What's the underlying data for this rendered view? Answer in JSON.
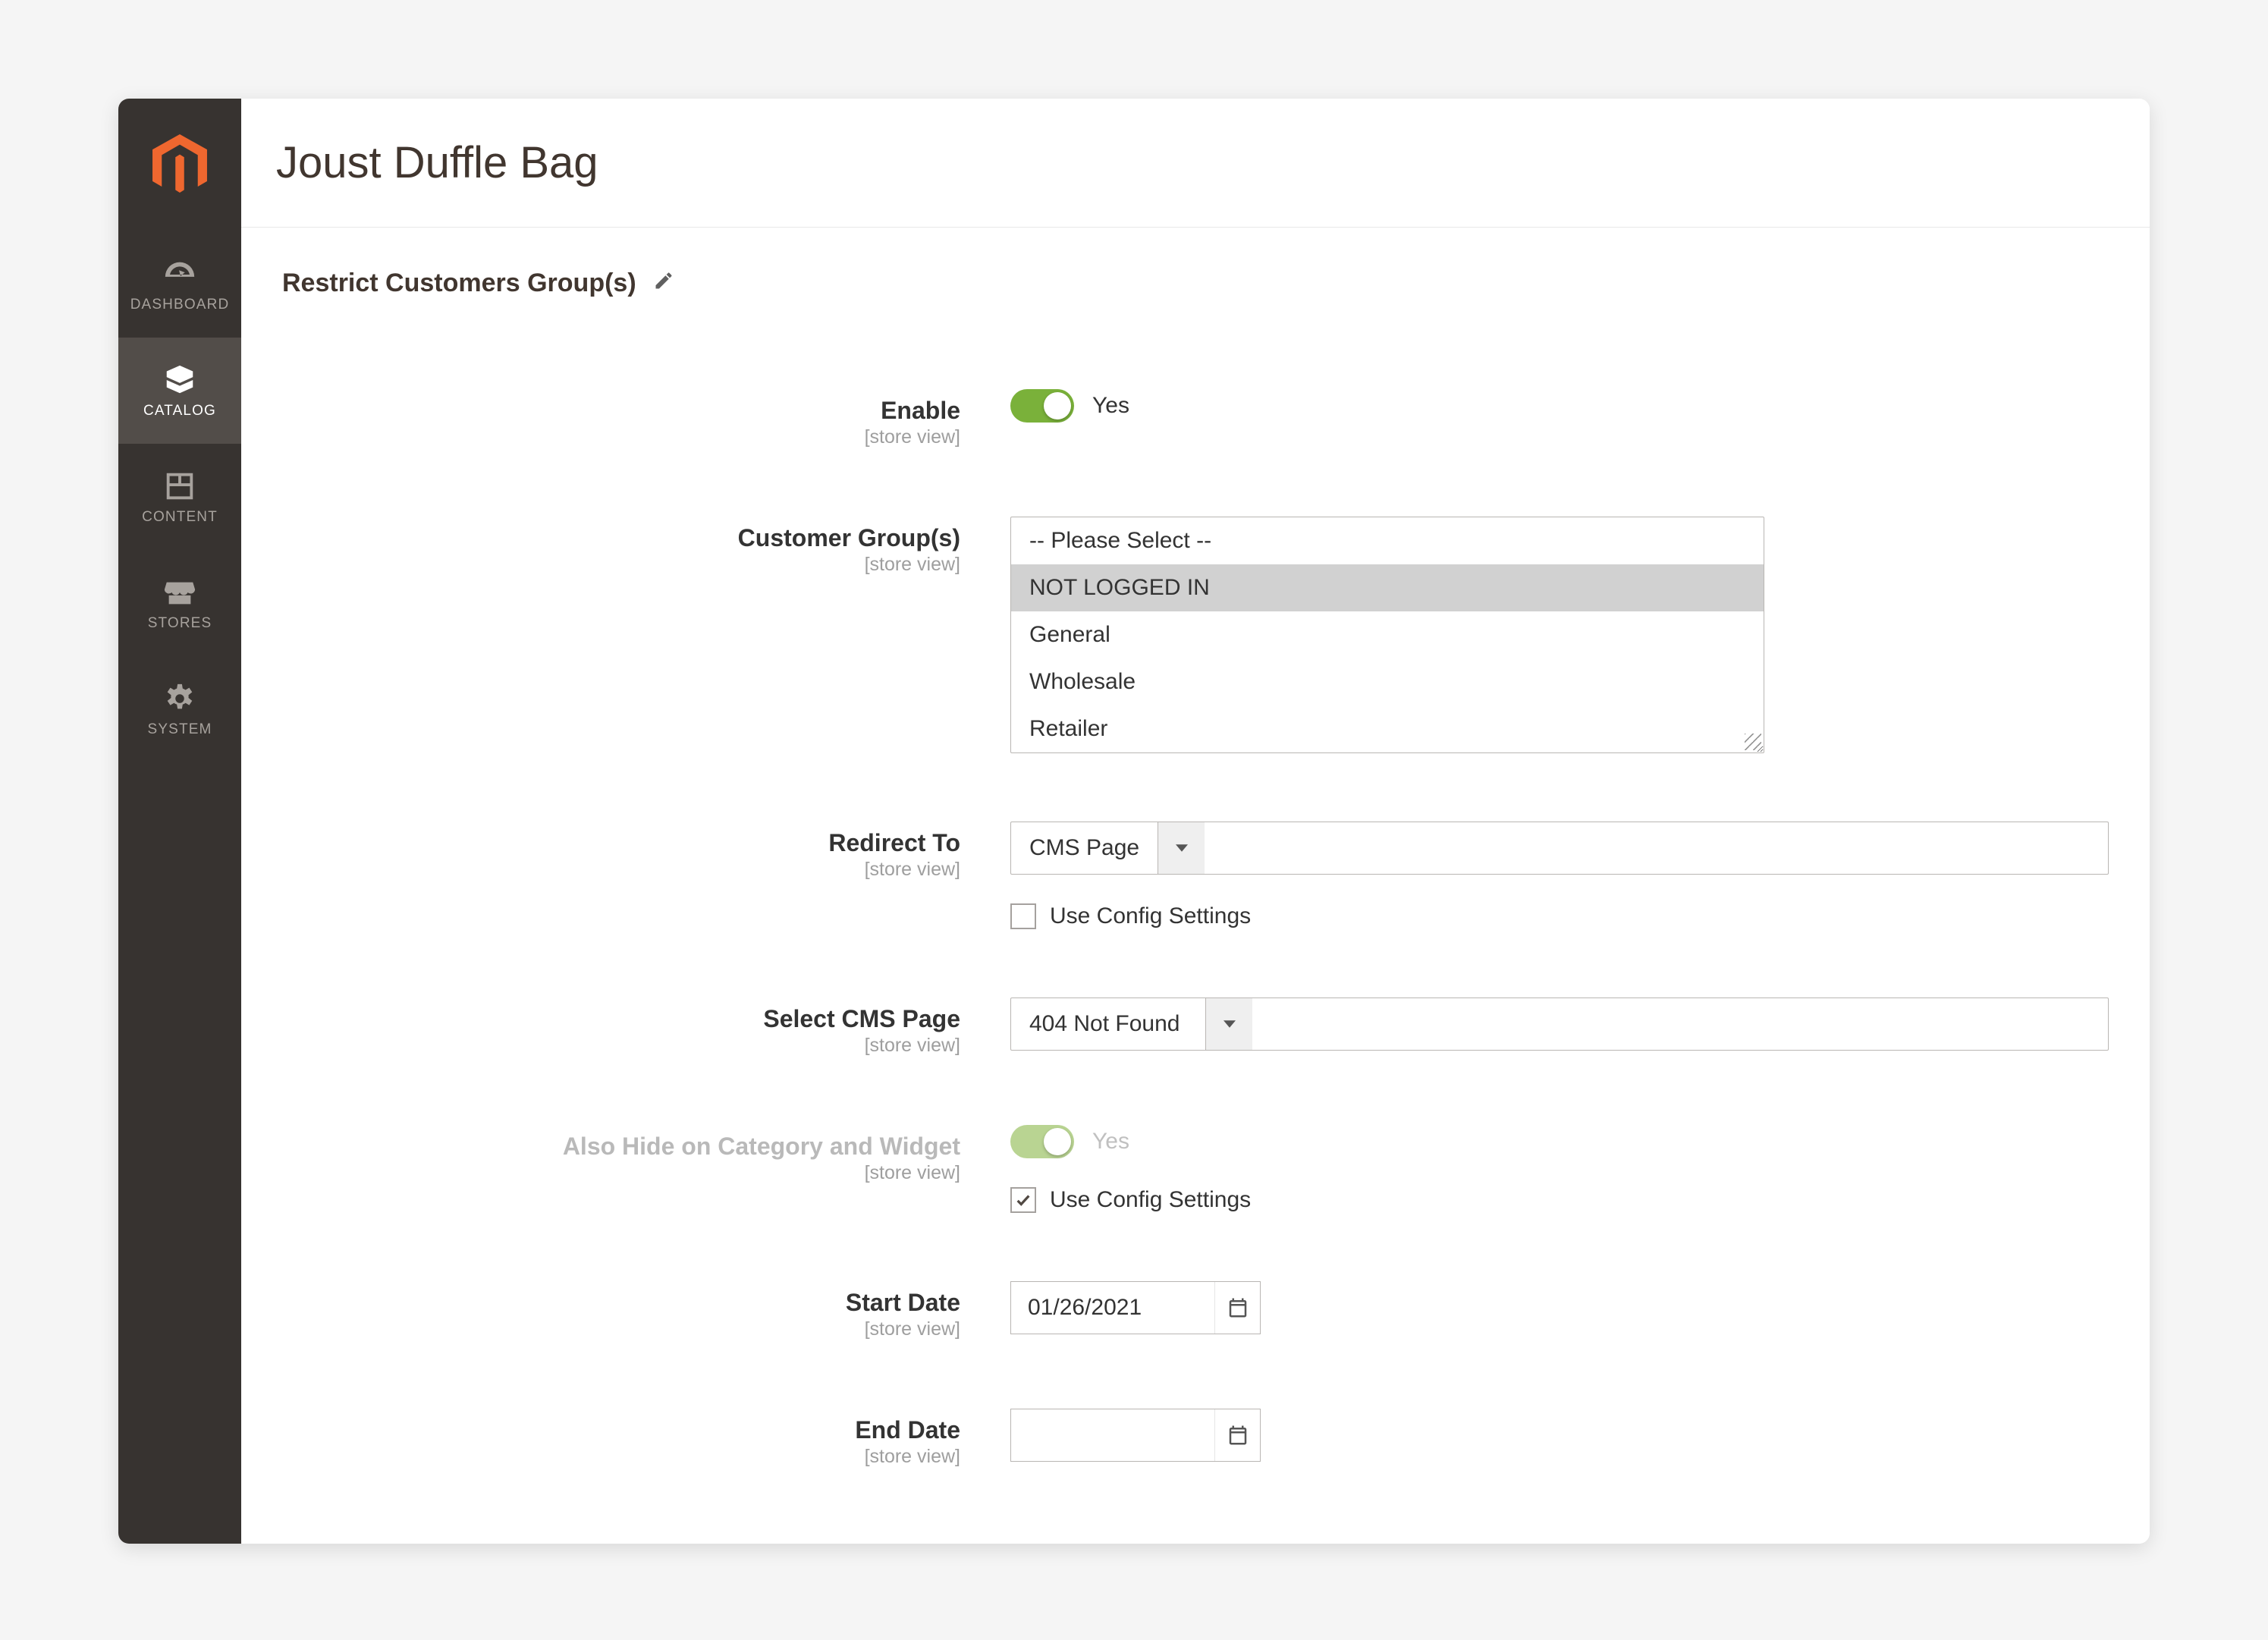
{
  "sidebar": {
    "items": [
      {
        "label": "DASHBOARD"
      },
      {
        "label": "CATALOG"
      },
      {
        "label": "CONTENT"
      },
      {
        "label": "STORES"
      },
      {
        "label": "SYSTEM"
      }
    ]
  },
  "page": {
    "title": "Joust Duffle Bag"
  },
  "section": {
    "title": "Restrict Customers Group(s)"
  },
  "scope_text": "[store view]",
  "fields": {
    "enable": {
      "label": "Enable",
      "value_text": "Yes"
    },
    "customer_groups": {
      "label": "Customer Group(s)",
      "options": [
        "-- Please Select --",
        "NOT LOGGED IN",
        "General",
        "Wholesale",
        "Retailer"
      ],
      "selected_index": 1
    },
    "redirect_to": {
      "label": "Redirect To",
      "value": "CMS Page",
      "use_config_label": "Use Config Settings",
      "use_config_checked": false
    },
    "select_cms": {
      "label": "Select CMS Page",
      "value": "404 Not Found"
    },
    "hide_category": {
      "label": "Also Hide on Category and Widget",
      "value_text": "Yes",
      "use_config_label": "Use Config Settings",
      "use_config_checked": true
    },
    "start_date": {
      "label": "Start Date",
      "value": "01/26/2021"
    },
    "end_date": {
      "label": "End Date",
      "value": ""
    }
  }
}
